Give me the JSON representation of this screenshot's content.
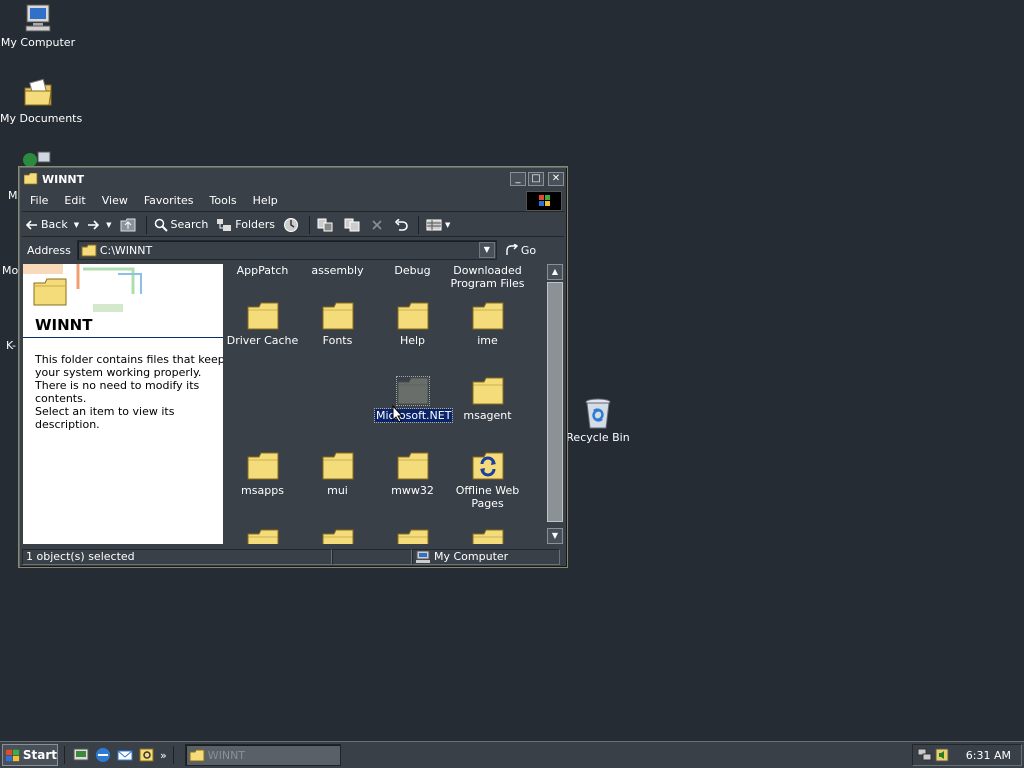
{
  "desktop": {
    "icons": [
      {
        "label": "My Computer"
      },
      {
        "label": "My Documents"
      },
      {
        "label": "Recycle Bin"
      }
    ],
    "cut_labels": [
      "M",
      "Mo",
      "K-"
    ]
  },
  "window": {
    "title": "WINNT",
    "menu": [
      "File",
      "Edit",
      "View",
      "Favorites",
      "Tools",
      "Help"
    ],
    "toolbar": {
      "back": "Back",
      "search": "Search",
      "folders": "Folders"
    },
    "address": {
      "label": "Address",
      "value": "C:\\WINNT",
      "go": "Go"
    },
    "info_pane": {
      "title": "WINNT",
      "description": "This folder contains files that keep your system working properly. There is no need to modify its contents.",
      "hint": "Select an item to view its description."
    },
    "files": [
      {
        "label": "AppPatch",
        "type": "folder"
      },
      {
        "label": "assembly",
        "type": "folder"
      },
      {
        "label": "Debug",
        "type": "folder"
      },
      {
        "label": "Downloaded Program Files",
        "type": "folder"
      },
      {
        "label": "Driver Cache",
        "type": "folder"
      },
      {
        "label": "Fonts",
        "type": "folder"
      },
      {
        "label": "Help",
        "type": "folder"
      },
      {
        "label": "ime",
        "type": "folder"
      },
      {
        "label": "Microsoft.NET",
        "type": "folder",
        "selected": true
      },
      {
        "label": "msagent",
        "type": "folder"
      },
      {
        "label": "msapps",
        "type": "folder"
      },
      {
        "label": "mui",
        "type": "folder"
      },
      {
        "label": "mww32",
        "type": "folder"
      },
      {
        "label": "Offline Web Pages",
        "type": "special-folder"
      }
    ],
    "status": {
      "selected": "1 object(s) selected",
      "zone": "My Computer"
    }
  },
  "taskbar": {
    "start": "Start",
    "task": "WINNT",
    "clock": "6:31 AM"
  },
  "colors": {
    "desktop": "#262c34",
    "chrome": "#3a4048",
    "folder": "#f5dc7a",
    "selection": "#0a246a"
  }
}
